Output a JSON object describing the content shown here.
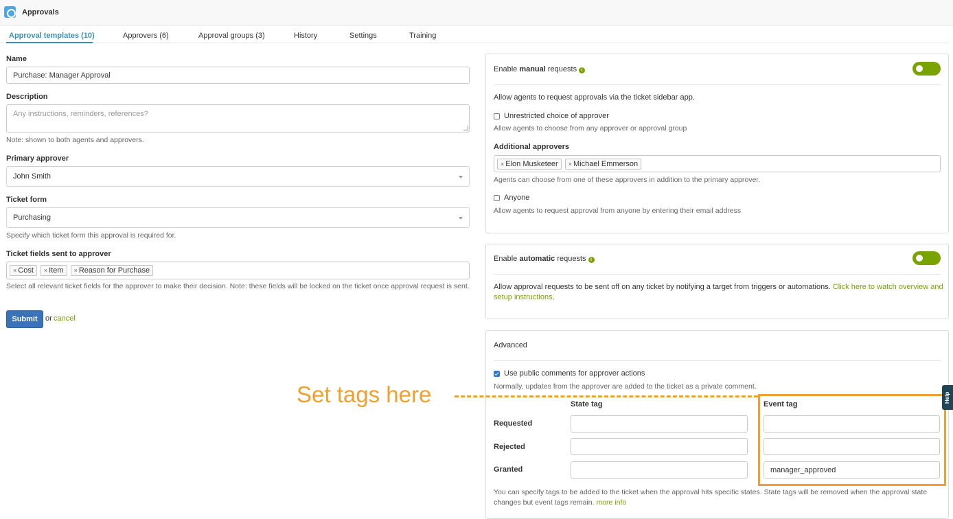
{
  "app": {
    "title": "Approvals"
  },
  "tabs": [
    {
      "label": "Approval templates (10)"
    },
    {
      "label": "Approvers (6)"
    },
    {
      "label": "Approval groups (3)"
    },
    {
      "label": "History"
    },
    {
      "label": "Settings"
    },
    {
      "label": "Training"
    }
  ],
  "form": {
    "name": {
      "label": "Name",
      "value": "Purchase: Manager Approval"
    },
    "description": {
      "label": "Description",
      "placeholder": "Any instructions, reminders, references?",
      "note": "Note: shown to both agents and approvers."
    },
    "primary_approver": {
      "label": "Primary approver",
      "value": "John Smith"
    },
    "ticket_form": {
      "label": "Ticket form",
      "value": "Purchasing",
      "note": "Specify which ticket form this approval is required for."
    },
    "ticket_fields": {
      "label": "Ticket fields sent to approver",
      "chips": [
        "Cost",
        "Item",
        "Reason for Purchase"
      ],
      "note": "Select all relevant ticket fields for the approver to make their decision. Note: these fields will be locked on the ticket once approval request is sent."
    },
    "submit_label": "Submit",
    "or_text": "or",
    "cancel_label": "cancel"
  },
  "manual": {
    "title_prefix": "Enable ",
    "title_bold": "manual",
    "title_suffix": " requests",
    "enabled": true,
    "description": "Allow agents to request approvals via the ticket sidebar app.",
    "unrestricted": {
      "label": "Unrestricted choice of approver",
      "checked": false,
      "note": "Allow agents to choose from any approver or approval group"
    },
    "additional_approvers": {
      "label": "Additional approvers",
      "chips": [
        "Elon Musketeer",
        "Michael Emmerson"
      ],
      "note": "Agents can choose from one of these approvers in addition to the primary approver."
    },
    "anyone": {
      "label": "Anyone",
      "checked": false,
      "note": "Allow agents to request approval from anyone by entering their email address"
    }
  },
  "automatic": {
    "title_prefix": "Enable ",
    "title_bold": "automatic",
    "title_suffix": " requests",
    "enabled": true,
    "description": "Allow approval requests to be sent off on any ticket by notifying a target from triggers or automations.",
    "link_line1": "Click here to watch overview and",
    "link_line2": "setup instructions",
    "link_period": "."
  },
  "advanced": {
    "title": "Advanced",
    "public_comments": {
      "label": "Use public comments for approver actions",
      "checked": true,
      "note": "Normally, updates from the approver are added to the ticket as a private comment."
    },
    "col_state": "State tag",
    "col_event": "Event tag",
    "rows": [
      {
        "label": "Requested",
        "state": "",
        "event": ""
      },
      {
        "label": "Rejected",
        "state": "",
        "event": ""
      },
      {
        "label": "Granted",
        "state": "",
        "event": "manager_approved"
      }
    ],
    "note": "You can specify tags to be added to the ticket when the approval hits specific states. State tags will be removed when the approval state changes but event tags remain.",
    "more_info": "more info"
  },
  "annotation": {
    "text": "Set tags here"
  },
  "help_tab": {
    "label": "Help"
  },
  "colors": {
    "accent": "#78a300",
    "tab_active": "#3a8fb7",
    "annotation": "#f0a030",
    "submit": "#3b73b9"
  }
}
